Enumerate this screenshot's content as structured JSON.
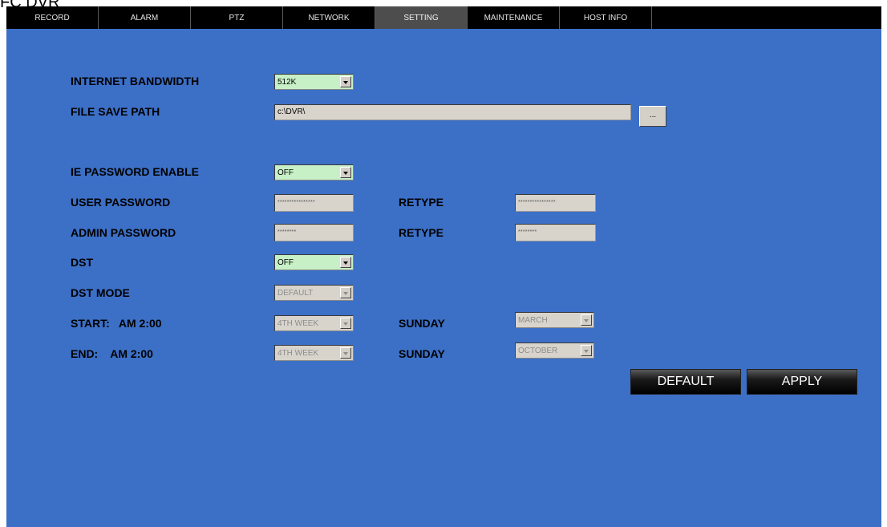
{
  "window_title": "FC DVR",
  "tabs": [
    {
      "label": "RECORD",
      "active": false
    },
    {
      "label": "ALARM",
      "active": false
    },
    {
      "label": "PTZ",
      "active": false
    },
    {
      "label": "NETWORK",
      "active": false
    },
    {
      "label": "SETTING",
      "active": true
    },
    {
      "label": "MAINTENANCE",
      "active": false
    },
    {
      "label": "HOST INFO",
      "active": false
    }
  ],
  "settings": {
    "internet_bandwidth": {
      "label": "INTERNET BANDWIDTH",
      "value": "512K"
    },
    "file_save_path": {
      "label": "FILE SAVE PATH",
      "value": "c:\\DVR\\",
      "browse_label": "..."
    },
    "ie_password_enable": {
      "label": "IE PASSWORD ENABLE",
      "value": "OFF"
    },
    "user_password": {
      "label": "USER PASSWORD",
      "value": "****************",
      "retype_label": "RETYPE",
      "retype_value": "****************"
    },
    "admin_password": {
      "label": "ADMIN PASSWORD",
      "value": "********",
      "retype_label": "RETYPE",
      "retype_value": "********"
    },
    "dst": {
      "label": "DST",
      "value": "OFF"
    },
    "dst_mode": {
      "label": "DST MODE",
      "value": "DEFAULT"
    },
    "start": {
      "label": "START:   AM 2:00",
      "week": "4TH WEEK",
      "day": "SUNDAY",
      "month": "MARCH"
    },
    "end": {
      "label": "END:    AM 2:00",
      "week": "4TH WEEK",
      "day": "SUNDAY",
      "month": "OCTOBER"
    }
  },
  "buttons": {
    "default": "DEFAULT",
    "apply": "APPLY"
  },
  "colors": {
    "panel_bg": "#3c6fc6",
    "tab_bar_bg": "#000000",
    "active_tab_bg": "#4d4d4d",
    "select_bg": "#c7f0c7",
    "disabled_bg": "#d8d4cc"
  }
}
